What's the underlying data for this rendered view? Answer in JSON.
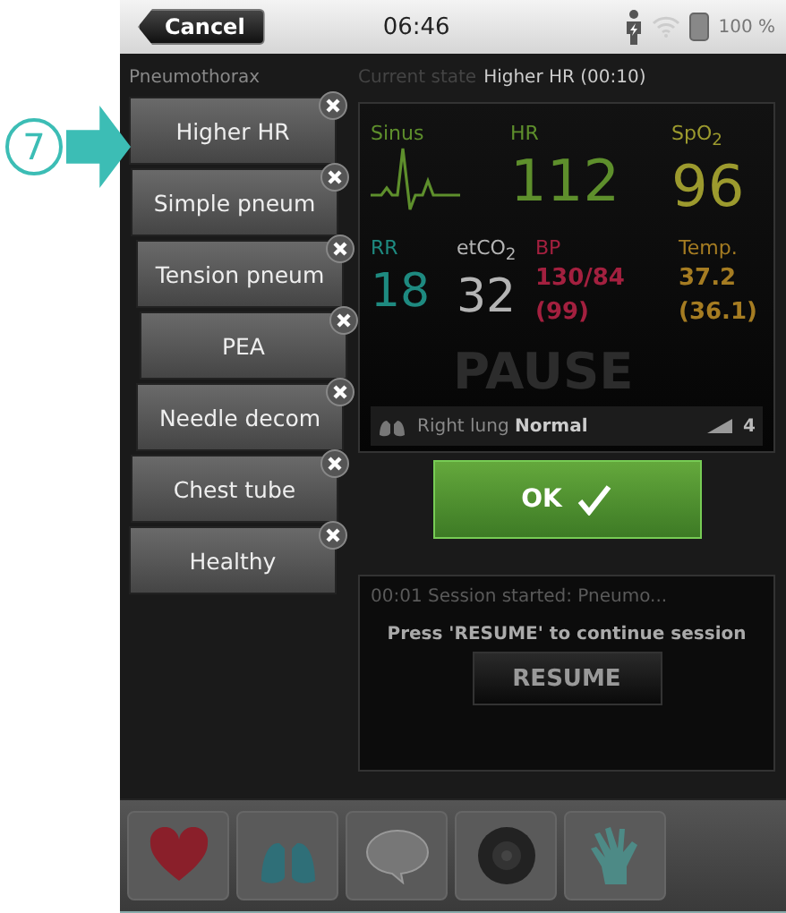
{
  "status_bar": {
    "cancel": "Cancel",
    "time": "06:46",
    "battery": "100 %"
  },
  "callout": {
    "number": "7"
  },
  "scenario": {
    "title": "Pneumothorax",
    "states": [
      {
        "label": "Higher HR"
      },
      {
        "label": "Simple pneum"
      },
      {
        "label": "Tension pneum"
      },
      {
        "label": "PEA"
      },
      {
        "label": "Needle decom"
      },
      {
        "label": "Chest tube"
      },
      {
        "label": "Healthy"
      }
    ]
  },
  "current_state": {
    "label": "Current state",
    "value": "Higher HR (00:10)"
  },
  "monitor": {
    "rhythm": {
      "label": "Sinus",
      "color": "#5e8f2c"
    },
    "top_vitals": [
      {
        "label": "HR",
        "value": "112",
        "color": "#5e8f2c"
      },
      {
        "label": "SpO$_{2}$",
        "value": "96",
        "color": "#9c9a2e"
      }
    ],
    "bottom_vitals": [
      {
        "kind": "big",
        "label": "RR",
        "value": "18",
        "color": "#1e8a80"
      },
      {
        "kind": "big",
        "label": "etCO$_{2}$",
        "value": "32",
        "color": "#b4b4b4"
      },
      {
        "kind": "pair",
        "label": "BP",
        "value": "130/84",
        "sub": "(99)",
        "color": "#a3203f"
      },
      {
        "kind": "pair",
        "label": "Temp.",
        "value": "37.2",
        "sub": "(36.1)",
        "color": "#a57c22"
      }
    ],
    "pause_text": "PAUSE",
    "lung": {
      "label": "Right lung",
      "value": "Normal",
      "count": "4"
    }
  },
  "ok_button": "OK",
  "log": {
    "entry": "00:01 Session started: Pneumo...",
    "message": "Press 'RESUME' to continue session",
    "button": "RESUME"
  },
  "toolbar": [
    {
      "kind": "heart"
    },
    {
      "kind": "lungs"
    },
    {
      "kind": "speech"
    },
    {
      "kind": "speaker"
    },
    {
      "kind": "glove"
    }
  ]
}
